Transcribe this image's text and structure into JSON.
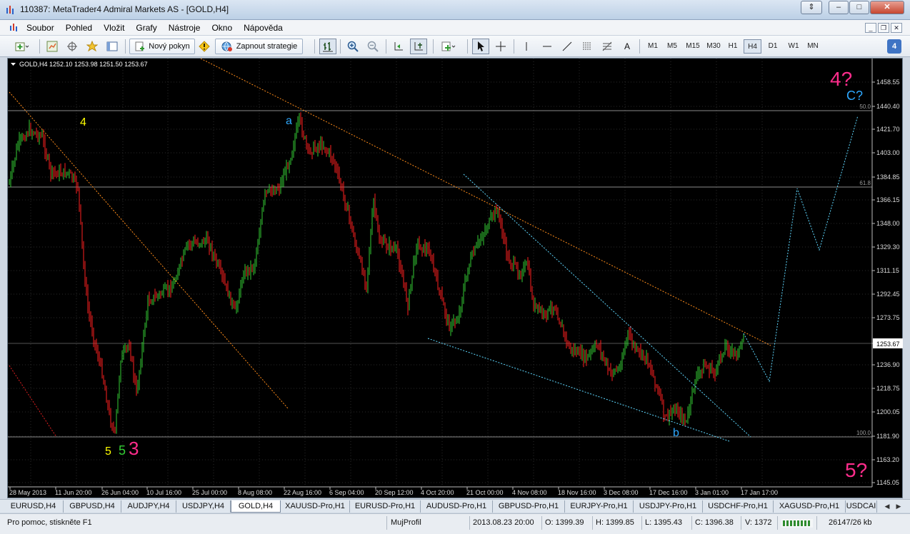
{
  "window": {
    "title": "110387: MetaTrader4 Admiral Markets AS - [GOLD,H4]"
  },
  "menu": [
    "Soubor",
    "Pohled",
    "Vložit",
    "Grafy",
    "Nástroje",
    "Okno",
    "Nápověda"
  ],
  "toolbar": {
    "new_order": "Nový pokyn",
    "strategies": "Zapnout strategie",
    "text_tool": "A",
    "timeframes": [
      "M1",
      "M5",
      "M15",
      "M30",
      "H1",
      "H4",
      "D1",
      "W1",
      "MN"
    ],
    "active_timeframe": "H4",
    "badge": "4"
  },
  "chart": {
    "header": "GOLD,H4  1252.10 1253.98 1251.50 1253.67",
    "price_labels": [
      "1458.55",
      "1440.40",
      "1421.70",
      "1403.00",
      "1384.85",
      "1366.15",
      "1348.00",
      "1329.30",
      "1311.15",
      "1292.45",
      "1273.75",
      "1253.67",
      "1236.90",
      "1218.75",
      "1200.05",
      "1181.90",
      "1163.20",
      "1145.05"
    ],
    "current_price": "1253.67",
    "time_labels": [
      "28 May 2013",
      "11 Jun 20:00",
      "26 Jun 04:00",
      "10 Jul 16:00",
      "25 Jul 00:00",
      "8 Aug 08:00",
      "22 Aug 16:00",
      "6 Sep 04:00",
      "20 Sep 12:00",
      "4 Oct 20:00",
      "21 Oct 00:00",
      "4 Nov 08:00",
      "18 Nov 16:00",
      "3 Dec 08:00",
      "17 Dec 16:00",
      "3 Jan 01:00",
      "17 Jan 17:00"
    ],
    "fib_levels": [
      "50.0",
      "61.8",
      "100.0"
    ],
    "wave_labels": [
      {
        "text": "4",
        "color": "#ffff00"
      },
      {
        "text": "a",
        "color": "#2ea8ff"
      },
      {
        "text": "5",
        "color": "#ffff00"
      },
      {
        "text": "5",
        "color": "#33cc33"
      },
      {
        "text": "3",
        "color": "#ff2d8c"
      },
      {
        "text": "b",
        "color": "#2ea8ff"
      },
      {
        "text": "4?",
        "color": "#ff2d8c"
      },
      {
        "text": "C?",
        "color": "#2ea8ff"
      },
      {
        "text": "5?",
        "color": "#ff2d8c"
      }
    ],
    "colors": {
      "background": "#000000",
      "bull": "#33cc33",
      "bear": "#ff2020",
      "grid": "#2a2a2a",
      "orange_line": "#ff8c1a",
      "cyan_line": "#5fd8ff"
    }
  },
  "tabs": [
    "EURUSD,H4",
    "GBPUSD,H4",
    "AUDJPY,H4",
    "USDJPY,H4",
    "GOLD,H4",
    "XAUUSD-Pro,H1",
    "EURUSD-Pro,H1",
    "AUDUSD-Pro,H1",
    "GBPUSD-Pro,H1",
    "EURJPY-Pro,H1",
    "USDJPY-Pro,H1",
    "USDCHF-Pro,H1",
    "XAGUSD-Pro,H1",
    "USDCAI"
  ],
  "active_tab": "GOLD,H4",
  "status": {
    "help": "Pro pomoc, stiskněte F1",
    "profile": "MujProfil",
    "datetime": "2013.08.23 20:00",
    "open": "O: 1399.39",
    "high": "H: 1399.85",
    "low": "L: 1395.43",
    "close": "C: 1396.38",
    "volume": "V: 1372",
    "traffic": "26147/26 kb"
  }
}
